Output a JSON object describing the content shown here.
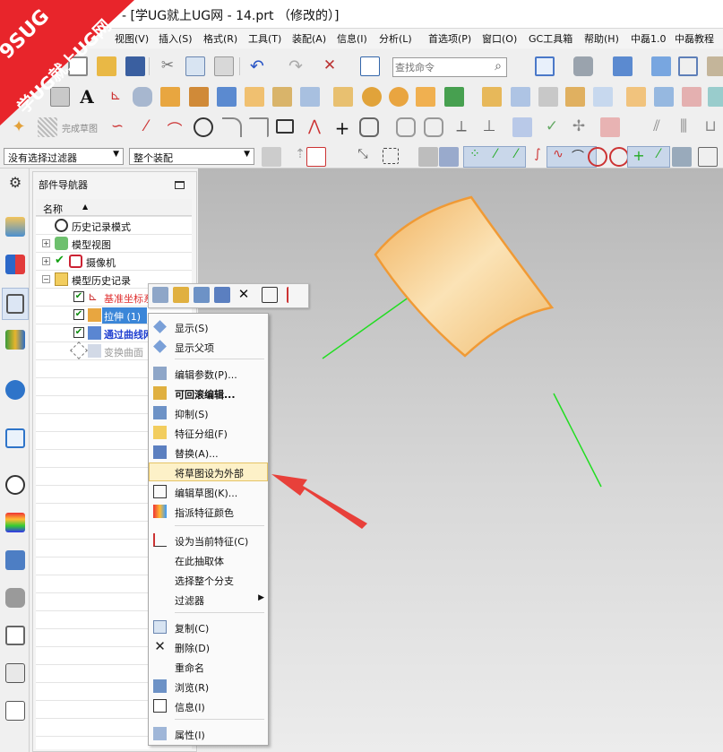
{
  "window": {
    "title": "- [学UG就上UG网 - 14.prt （修改的）]"
  },
  "watermark": {
    "line1": "9SUG",
    "line2": "学UG就上UG网"
  },
  "menubar": [
    {
      "label": "视图(V)"
    },
    {
      "label": "插入(S)"
    },
    {
      "label": "格式(R)"
    },
    {
      "label": "工具(T)"
    },
    {
      "label": "装配(A)"
    },
    {
      "label": "信息(I)"
    },
    {
      "label": "分析(L)"
    },
    {
      "label": "首选项(P)"
    },
    {
      "label": "窗口(O)"
    },
    {
      "label": "GC工具箱"
    },
    {
      "label": "帮助(H)"
    },
    {
      "label": "中磊1.0"
    },
    {
      "label": "中磊教程"
    }
  ],
  "toolbar": {
    "search_placeholder": "查找命令",
    "finish_sketch_label": "完成草图"
  },
  "filters": {
    "selection_filter": "没有选择过滤器",
    "assembly_scope": "整个装配"
  },
  "navigator": {
    "title": "部件导航器",
    "column_name": "名称",
    "items": [
      {
        "label": "历史记录模式",
        "color": "#111111"
      },
      {
        "label": "模型视图",
        "color": "#111111"
      },
      {
        "label": "摄像机",
        "color": "#111111"
      },
      {
        "label": "模型历史记录",
        "color": "#111111"
      },
      {
        "label": "基准坐标系",
        "color": "#e03030"
      },
      {
        "label": "拉伸 (1)",
        "color": "#ffffff"
      },
      {
        "label": "通过曲线网格",
        "color": "#1f3fd0"
      },
      {
        "label": "变换曲面",
        "color": "#9a9a9a"
      }
    ]
  },
  "context_menu": {
    "items": [
      {
        "label": "显示(S)",
        "icon": "show-icon"
      },
      {
        "label": "显示父项",
        "icon": "show-parents-icon"
      },
      {
        "label": "编辑参数(P)...",
        "icon": "edit-params-icon"
      },
      {
        "label": "可回滚编辑...",
        "icon": "rollback-edit-icon"
      },
      {
        "label": "抑制(S)",
        "icon": "suppress-icon"
      },
      {
        "label": "特征分组(F)",
        "icon": "feature-group-icon"
      },
      {
        "label": "替换(A)...",
        "icon": "replace-icon"
      },
      {
        "label": "将草图设为外部",
        "icon": ""
      },
      {
        "label": "编辑草图(K)...",
        "icon": "edit-sketch-icon"
      },
      {
        "label": "指派特征颜色",
        "icon": "assign-color-icon"
      },
      {
        "label": "设为当前特征(C)",
        "icon": "make-current-icon"
      },
      {
        "label": "在此抽取体",
        "icon": ""
      },
      {
        "label": "选择整个分支",
        "icon": ""
      },
      {
        "label": "过滤器",
        "icon": ""
      },
      {
        "label": "复制(C)",
        "icon": "copy-icon"
      },
      {
        "label": "删除(D)",
        "icon": "delete-icon"
      },
      {
        "label": "重命名",
        "icon": ""
      },
      {
        "label": "浏览(R)",
        "icon": "browse-icon"
      },
      {
        "label": "信息(I)",
        "icon": "info-icon"
      },
      {
        "label": "属性(I)",
        "icon": "properties-icon"
      }
    ]
  },
  "colors": {
    "accent_highlight": "#fdf1c8",
    "arrow": "#e8403a",
    "surface": "#f6c27a",
    "curve": "#22dd22"
  }
}
